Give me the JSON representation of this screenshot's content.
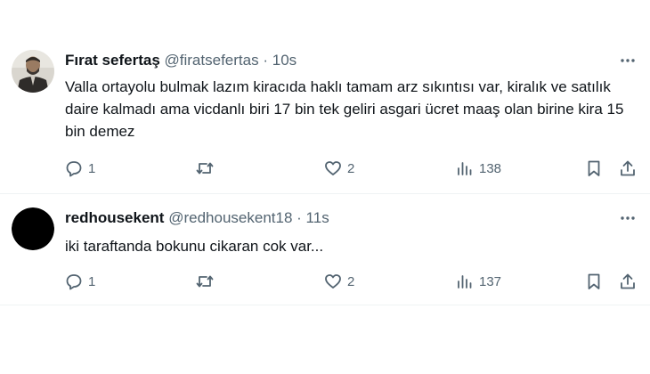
{
  "tweets": [
    {
      "name": "Fırat sefertaş",
      "handle": "@firatsefertas",
      "separator": "·",
      "time": "10s",
      "text": "Valla ortayolu bulmak lazım kiracıda haklı tamam arz sıkıntısı var, kiralık ve satılık daire kalmadı ama vicdanlı biri 17 bin tek geliri asgari ücret maaş olan birine kira 15 bin demez",
      "replies": "1",
      "retweets": "",
      "likes": "2",
      "views": "138",
      "icons": [
        "more-icon",
        "reply-icon",
        "retweet-icon",
        "like-icon",
        "views-icon",
        "bookmark-icon",
        "share-icon"
      ]
    },
    {
      "name": "redhousekent",
      "handle": "@redhousekent18",
      "separator": "·",
      "time": "11s",
      "text": "iki taraftanda bokunu cikaran cok var...",
      "replies": "1",
      "retweets": "",
      "likes": "2",
      "views": "137",
      "icons": [
        "more-icon",
        "reply-icon",
        "retweet-icon",
        "like-icon",
        "views-icon",
        "bookmark-icon",
        "share-icon"
      ]
    }
  ],
  "colors": {
    "text_primary": "#0f1419",
    "text_secondary": "#536471",
    "divider": "#eff3f4",
    "background": "#ffffff"
  }
}
